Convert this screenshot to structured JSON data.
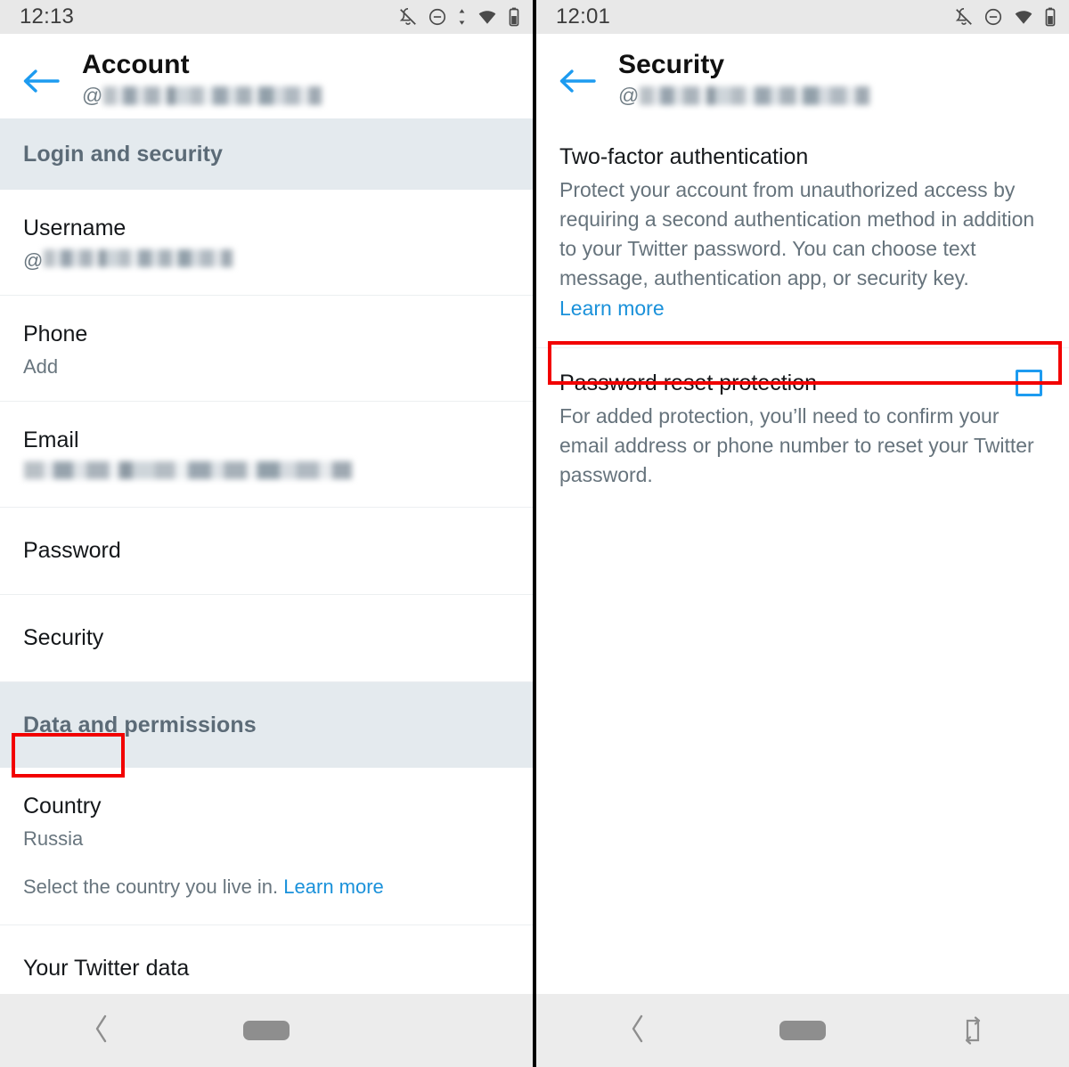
{
  "left_screen": {
    "status_bar": {
      "time": "12:13",
      "icons": [
        "bell-off-icon",
        "do-not-disturb-icon",
        "data-transfer-icon",
        "wifi-icon",
        "battery-icon"
      ]
    },
    "app_bar": {
      "back_label": "back-arrow",
      "title": "Account",
      "handle_prefix": "@",
      "handle_redacted": true
    },
    "sections": [
      {
        "header": "Login and security",
        "rows": [
          {
            "title": "Username",
            "sub_prefix": "@",
            "sub_redacted": true
          },
          {
            "title": "Phone",
            "sub": "Add"
          },
          {
            "title": "Email",
            "sub_redacted": true
          },
          {
            "title": "Password"
          },
          {
            "title": "Security",
            "highlighted": true
          }
        ]
      },
      {
        "header": "Data and permissions",
        "rows": [
          {
            "title": "Country",
            "sub": "Russia",
            "hint": "Select the country you live in.",
            "hint_link": "Learn more"
          },
          {
            "title": "Your Twitter data"
          }
        ]
      }
    ],
    "nav_bar": {
      "back": "back-chevron",
      "home": "home-pill"
    }
  },
  "right_screen": {
    "status_bar": {
      "time": "12:01",
      "icons": [
        "bell-off-icon",
        "do-not-disturb-icon",
        "wifi-icon",
        "battery-icon"
      ]
    },
    "app_bar": {
      "back_label": "back-arrow",
      "title": "Security",
      "handle_prefix": "@",
      "handle_redacted": true
    },
    "two_factor": {
      "title": "Two-factor authentication",
      "body": "Protect your account from unauthorized access by requiring a second authentication method in addition to your Twitter password. You can choose text message, authentication app, or security key.",
      "link": "Learn more"
    },
    "password_reset_protection": {
      "label": "Password reset protection",
      "checked": false,
      "description": "For added protection, you’ll need to confirm your email address or phone number to reset your Twitter password.",
      "highlighted": true
    },
    "nav_bar": {
      "back": "back-chevron",
      "home": "home-pill",
      "rotate": "screen-rotate"
    }
  },
  "colors": {
    "accent_blue": "#1a91da",
    "checkbox_blue": "#1d9bf0",
    "highlight_red": "#f20000",
    "section_band": "#e4eaee",
    "status_bar": "#e8e8e8",
    "nav_bar": "#ececec"
  }
}
